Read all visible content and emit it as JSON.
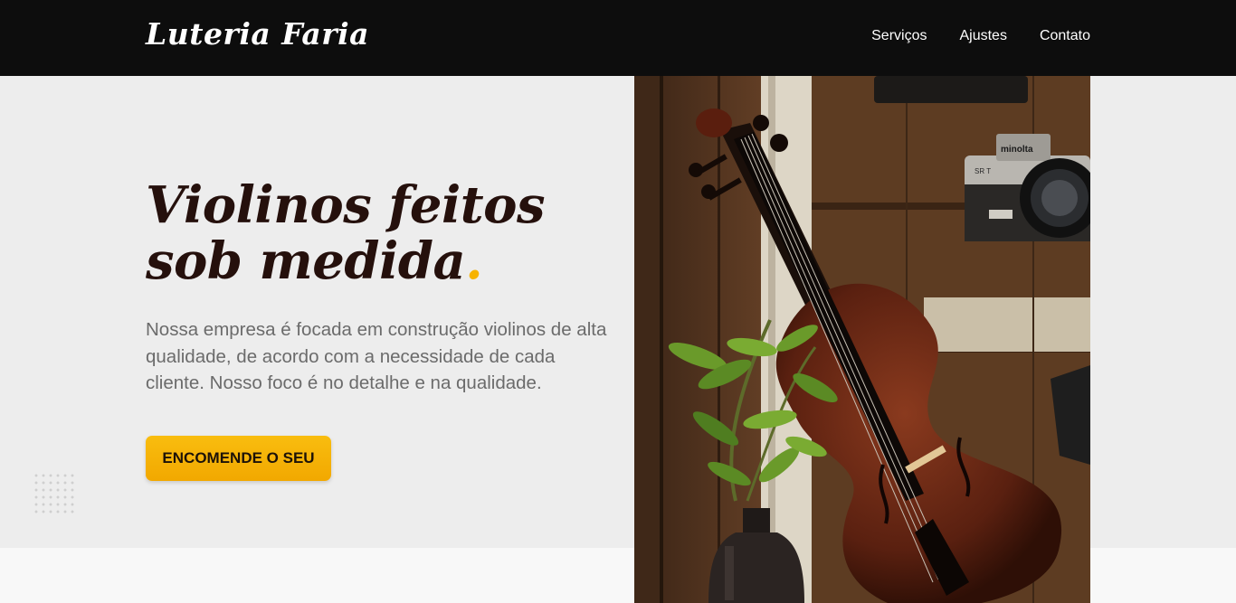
{
  "header": {
    "logo": "Luteria Faria",
    "nav": [
      "Serviços",
      "Ajustes",
      "Contato"
    ]
  },
  "hero": {
    "headline_main": "Violinos feitos sob medida",
    "headline_dot": ".",
    "description": "Nossa empresa é focada em construção violinos de alta qualidade, de acordo com a necessidade de cada cliente. Nosso foco é no detalhe e na qualidade.",
    "cta_label": "ENCOMENDE O SEU"
  },
  "photo": {
    "camera_brand": "minolta",
    "camera_model": "SR T"
  },
  "colors": {
    "header_bg": "#0d0d0d",
    "hero_bg": "#ededed",
    "accent": "#f7b300",
    "headline": "#25100c",
    "body_text": "#6b6b6b"
  }
}
